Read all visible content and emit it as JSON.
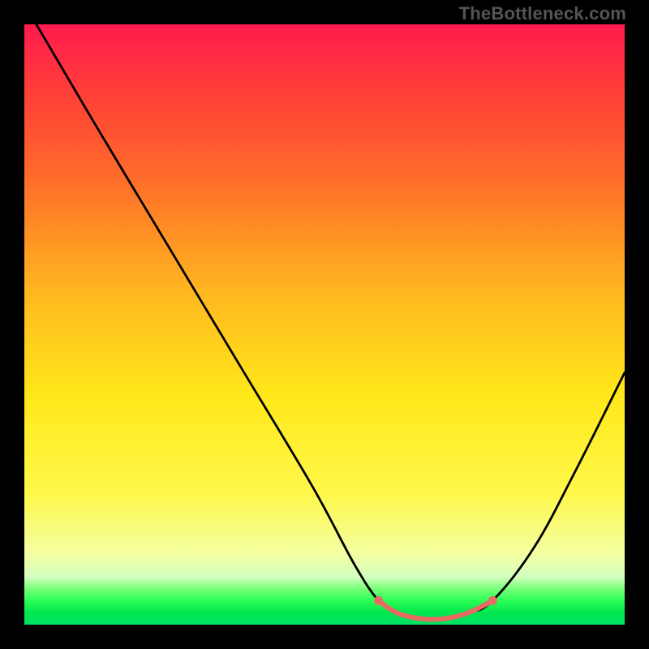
{
  "watermark": "TheBottleneck.com",
  "chart_data": {
    "type": "line",
    "title": "",
    "xlabel": "",
    "ylabel": "",
    "xlim": [
      0,
      100
    ],
    "ylim": [
      0,
      100
    ],
    "grid": false,
    "series": [
      {
        "name": "curve",
        "x": [
          2,
          12,
          24,
          36,
          48,
          55,
          59,
          62,
          66,
          70,
          74,
          78,
          85,
          92,
          100
        ],
        "values": [
          100,
          83,
          63,
          43,
          23,
          10,
          4,
          2,
          1,
          1,
          2,
          4,
          13,
          26,
          42
        ]
      }
    ],
    "highlight_segment": {
      "x": [
        59,
        62,
        66,
        70,
        74,
        78
      ],
      "values": [
        4,
        2,
        1,
        1,
        2,
        4
      ],
      "endpoint_dots": [
        {
          "x": 59,
          "y": 4
        },
        {
          "x": 78,
          "y": 4
        }
      ]
    },
    "colors": {
      "curve": "#000000",
      "highlight": "#e96a63",
      "gradient_top": "#ff1a4d",
      "gradient_upper": "#ffb81f",
      "gradient_mid": "#fff84a",
      "gradient_green": "#2bff56"
    }
  }
}
